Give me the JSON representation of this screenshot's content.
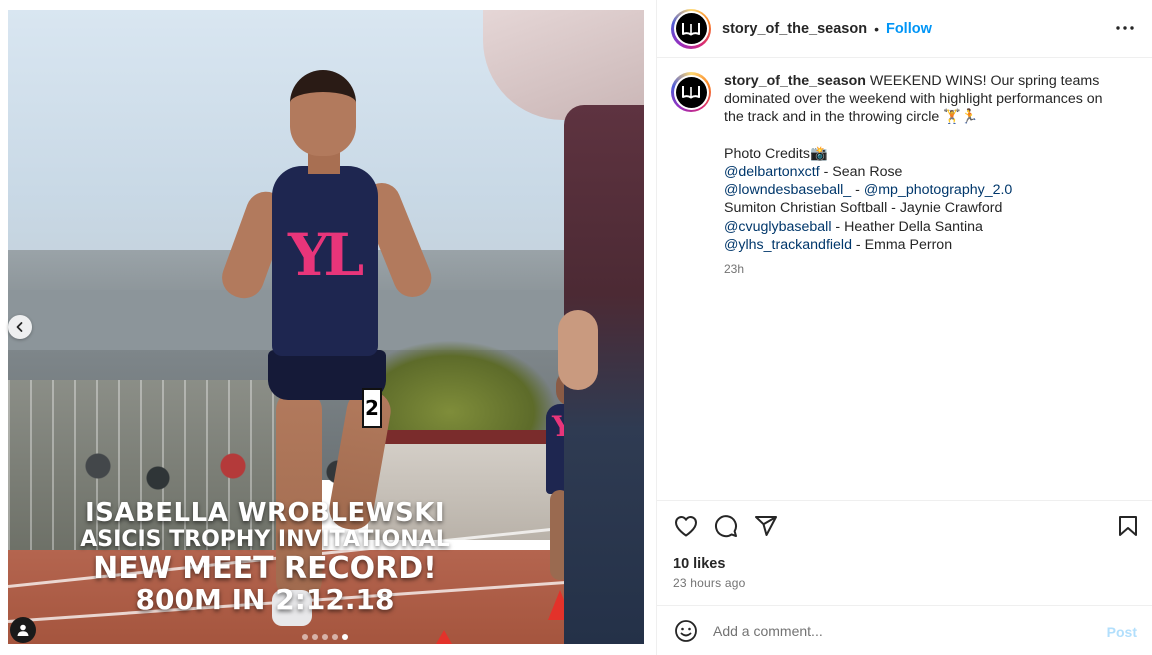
{
  "post": {
    "username": "story_of_the_season",
    "separator": "•",
    "follow_label": "Follow",
    "more_icon": "more-horizontal-icon"
  },
  "media": {
    "overlay_lines": [
      "ISABELLA WROBLEWSKI",
      "ASICIS TROPHY INVITATIONAL",
      "NEW MEET RECORD!",
      "800M IN 2:12.18"
    ],
    "jersey_mark": "YL",
    "bib_number": "2",
    "carousel": {
      "total": 5,
      "active_index": 4
    },
    "prev_icon": "chevron-left-icon",
    "tag_icon": "user-tag-icon"
  },
  "caption": {
    "username": "story_of_the_season",
    "text_1": " WEEKEND WINS! Our spring teams",
    "text_2": "dominated over the weekend with highlight performances on",
    "text_3": "the track and in the throwing circle 🏋️🏃",
    "credits_title": "Photo Credits📸",
    "credits": [
      {
        "handle": "@delbartonxctf",
        "rest": " - Sean Rose"
      },
      {
        "handle": "@lowndesbaseball_",
        "mid": " - ",
        "handle2": "@mp_photography_2.0"
      },
      {
        "plain": "Sumiton Christian Softball - Jaynie Crawford"
      },
      {
        "handle": "@cvuglybaseball",
        "rest": " - Heather Della Santina"
      },
      {
        "handle": "@ylhs_trackandfield",
        "rest": " - Emma Perron"
      }
    ],
    "time": "23h"
  },
  "actions": {
    "like_icon": "heart-icon",
    "comment_icon": "comment-icon",
    "share_icon": "send-icon",
    "save_icon": "bookmark-icon"
  },
  "stats": {
    "likes": "10 likes",
    "posted": "23 hours ago"
  },
  "comment": {
    "placeholder": "Add a comment...",
    "post_label": "Post",
    "emoji_icon": "smiley-icon"
  },
  "colors": {
    "link": "#00376b",
    "follow": "#0095f6",
    "post_disabled": "#b2dffc",
    "secondary_text": "#737373"
  }
}
